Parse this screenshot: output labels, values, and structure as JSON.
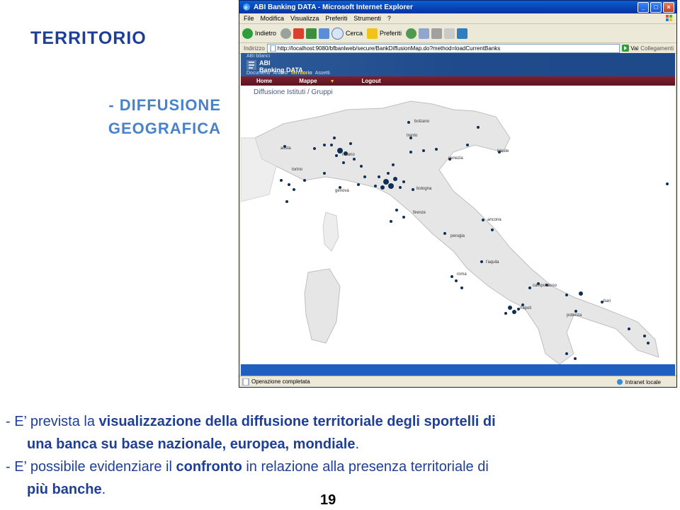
{
  "slide": {
    "title": "TERRITORIO",
    "subtitle_line1": "- DIFFUSIONE",
    "subtitle_line2": "GEOGRAFICA",
    "page_number": "19"
  },
  "browser": {
    "title": "ABI Banking DATA - Microsoft Internet Explorer",
    "menu": [
      "File",
      "Modifica",
      "Visualizza",
      "Preferiti",
      "Strumenti",
      "?"
    ],
    "toolbar": {
      "back_label": "Indietro",
      "search_label": "Cerca",
      "favorites_label": "Preferiti"
    },
    "address_label": "Indirizzo",
    "address_value": "http://localhost:9080/bfbanlweb/secure/BankDiffusionMap.do?method=loadCurrentBanks",
    "go_label": "Vai",
    "links_label": "Collegamenti",
    "status_text": "Operazione completata",
    "zone_text": "Intranet locale"
  },
  "app": {
    "logo_small": "ABI bilanci",
    "logo_line1": "ABI",
    "logo_line2": "Banking DATA",
    "top_nav": [
      "Documenti",
      "Analisi",
      "Territorio",
      "Assetti"
    ],
    "top_nav_selected": 2,
    "nav": {
      "home": "Home",
      "mappe": "Mappe",
      "logout": "Logout"
    },
    "heading": "Diffusione Istituti / Gruppi"
  },
  "map": {
    "cities": [
      "bolzano",
      "trento",
      "trieste",
      "venezia",
      "aosta",
      "milano",
      "torino",
      "genova",
      "bologna",
      "firenze",
      "ancona",
      "perugia",
      "l'aquila",
      "roma",
      "campobasso",
      "bari",
      "napoli",
      "potenza"
    ],
    "colors": {
      "land": "#e6e6e6",
      "marker": "#0f2f55",
      "sea": "#ffffff"
    }
  },
  "bullets": {
    "b1_dash": "- E’",
    "b1_text1": " prevista la ",
    "b1_bold1": "visualizzazione della diffusione territoriale degli sportelli di",
    "b1_bold2": "una banca su base nazionale, europea, mondiale",
    "b1_end": ".",
    "b2_text1": "- E’ possibile evidenziare il ",
    "b2_bold1": "confronto",
    "b2_text2": " in relazione alla presenza territoriale di",
    "b2_bold2": "più banche",
    "b2_end": "."
  }
}
